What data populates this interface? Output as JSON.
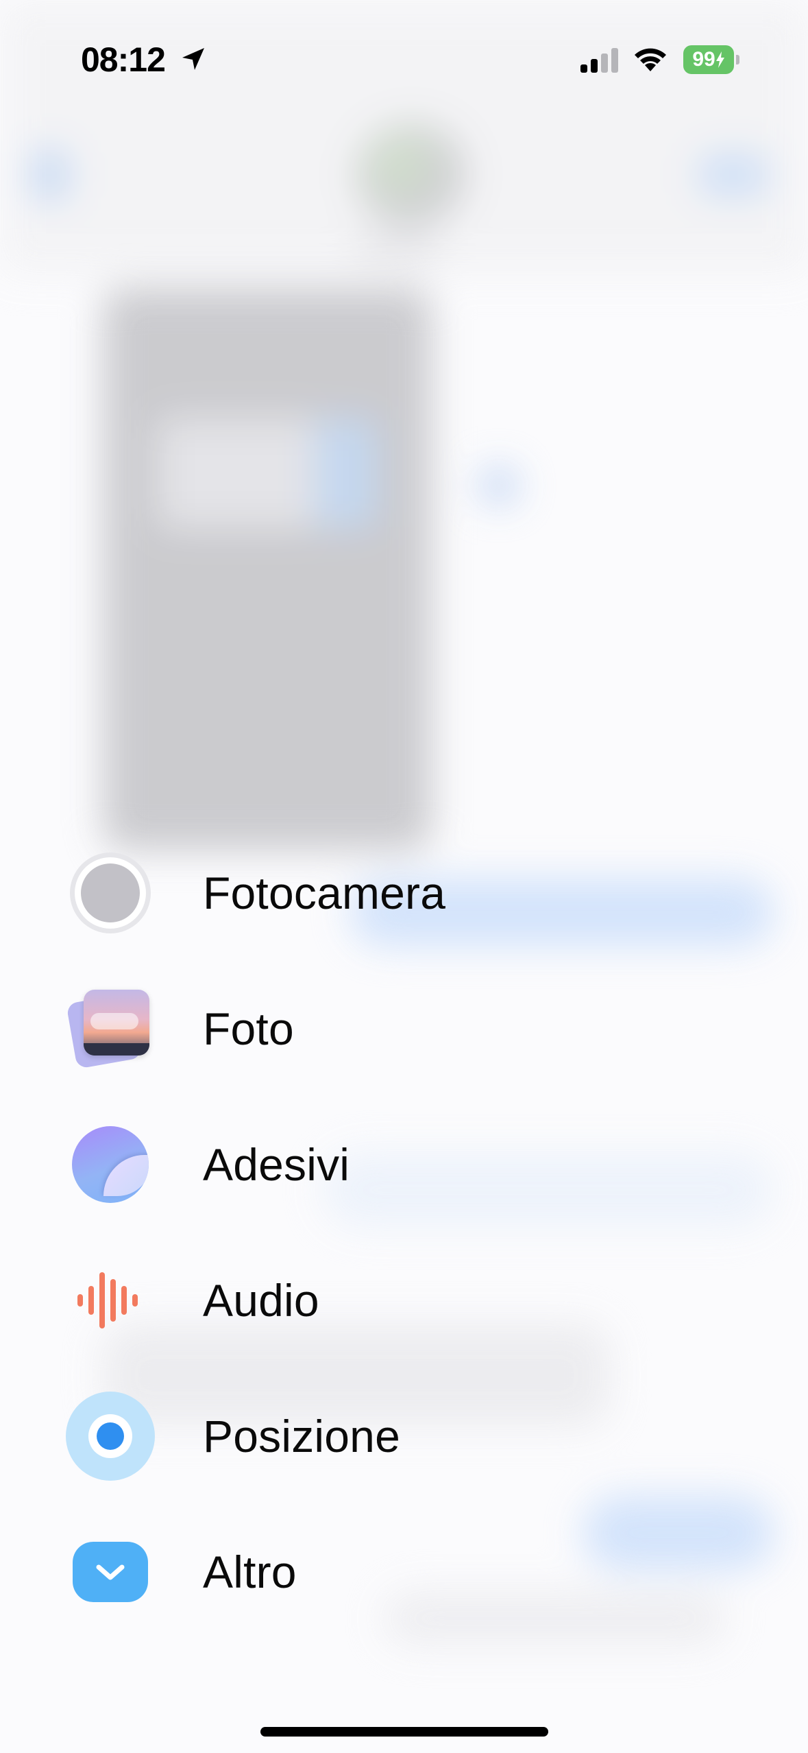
{
  "status_bar": {
    "time": "08:12",
    "battery": "99",
    "icons": [
      "location-arrow-icon",
      "cellular-signal-icon",
      "wifi-icon",
      "battery-charging-icon"
    ]
  },
  "menu": {
    "items": [
      {
        "label": "Fotocamera",
        "icon": "camera-icon"
      },
      {
        "label": "Foto",
        "icon": "photos-icon"
      },
      {
        "label": "Adesivi",
        "icon": "stickers-icon"
      },
      {
        "label": "Audio",
        "icon": "audio-waveform-icon"
      },
      {
        "label": "Posizione",
        "icon": "location-icon"
      },
      {
        "label": "Altro",
        "icon": "chevron-down-icon"
      }
    ]
  },
  "colors": {
    "battery_green": "#65c466",
    "audio_orange": "#f27a5e",
    "location_blue": "#2f8ff0",
    "more_blue": "#4fb0f6"
  }
}
